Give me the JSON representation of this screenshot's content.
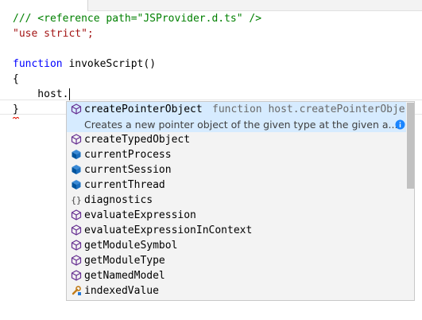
{
  "editor": {
    "lines": [
      {
        "a": "/// <reference path=\"JSProvider.d.ts\" />"
      },
      {
        "a": "\"use strict\";"
      },
      {
        "a": ""
      },
      {
        "kw": "function",
        "rest": " invokeScript()"
      },
      {
        "a": "{"
      },
      {
        "a": "    host."
      },
      {
        "a": "}"
      }
    ]
  },
  "suggest": {
    "selected": {
      "label": "createPointerObject",
      "detail": "function host.createPointerObje...",
      "doc": "Creates a new pointer object of the given type at the given a...",
      "icon": "method-cube-icon",
      "info_icon": "info-icon"
    },
    "items": [
      {
        "label": "createTypedObject",
        "icon": "method-cube-icon"
      },
      {
        "label": "currentProcess",
        "icon": "field-cube-icon"
      },
      {
        "label": "currentSession",
        "icon": "field-cube-icon"
      },
      {
        "label": "currentThread",
        "icon": "field-cube-icon"
      },
      {
        "label": "diagnostics",
        "icon": "namespace-braces-icon"
      },
      {
        "label": "evaluateExpression",
        "icon": "method-cube-icon"
      },
      {
        "label": "evaluateExpressionInContext",
        "icon": "method-cube-icon"
      },
      {
        "label": "getModuleSymbol",
        "icon": "method-cube-icon"
      },
      {
        "label": "getModuleType",
        "icon": "method-cube-icon"
      },
      {
        "label": "getNamedModel",
        "icon": "method-cube-icon"
      },
      {
        "label": "indexedValue",
        "icon": "property-wrench-icon"
      }
    ],
    "colors": {
      "method": "#652d90",
      "field": "#00539c",
      "property": "#c27d1a",
      "info": "#1a85ff",
      "selection": "#d6ebff"
    }
  }
}
